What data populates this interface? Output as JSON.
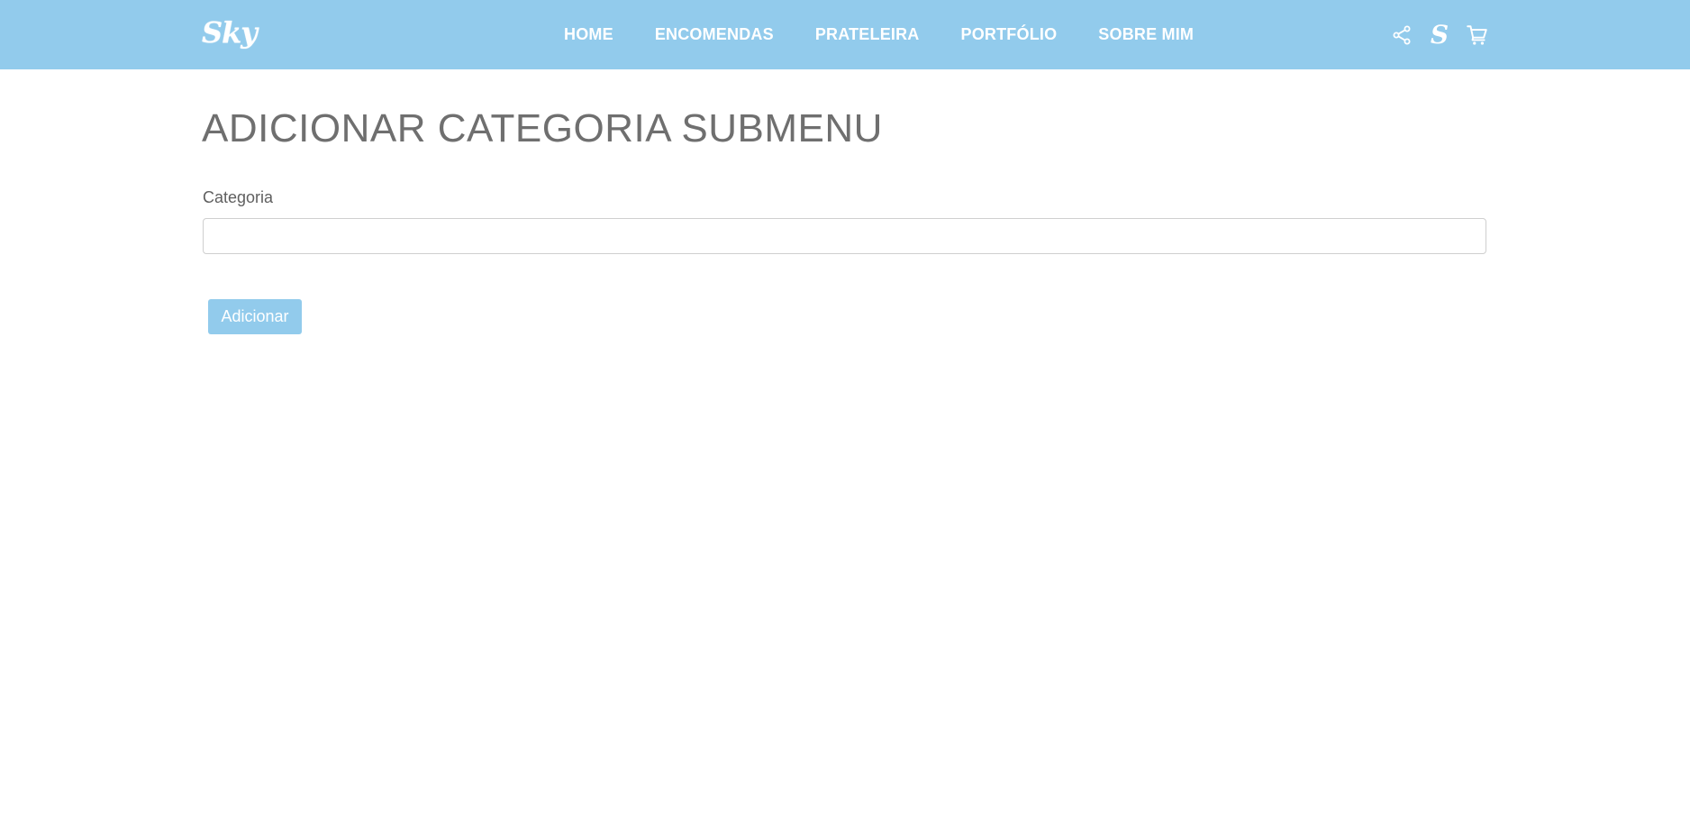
{
  "brand": {
    "logo_text": "Sky"
  },
  "nav": {
    "items": [
      {
        "label": "HOME"
      },
      {
        "label": "ENCOMENDAS"
      },
      {
        "label": "PRATELEIRA"
      },
      {
        "label": "PORTFÓLIO"
      },
      {
        "label": "SOBRE MIM"
      }
    ],
    "icons": [
      {
        "name": "share-icon"
      },
      {
        "name": "s-logo-icon",
        "glyph": "S"
      },
      {
        "name": "cart-icon"
      }
    ]
  },
  "page": {
    "title": "ADICIONAR CATEGORIA SUBMENU"
  },
  "form": {
    "category_label": "Categoria",
    "category_value": "",
    "category_placeholder": "",
    "submit_label": "Adicionar"
  },
  "colors": {
    "nav_background": "#92cbec",
    "button_background": "#92cbec",
    "text": "#6f6f6f"
  }
}
